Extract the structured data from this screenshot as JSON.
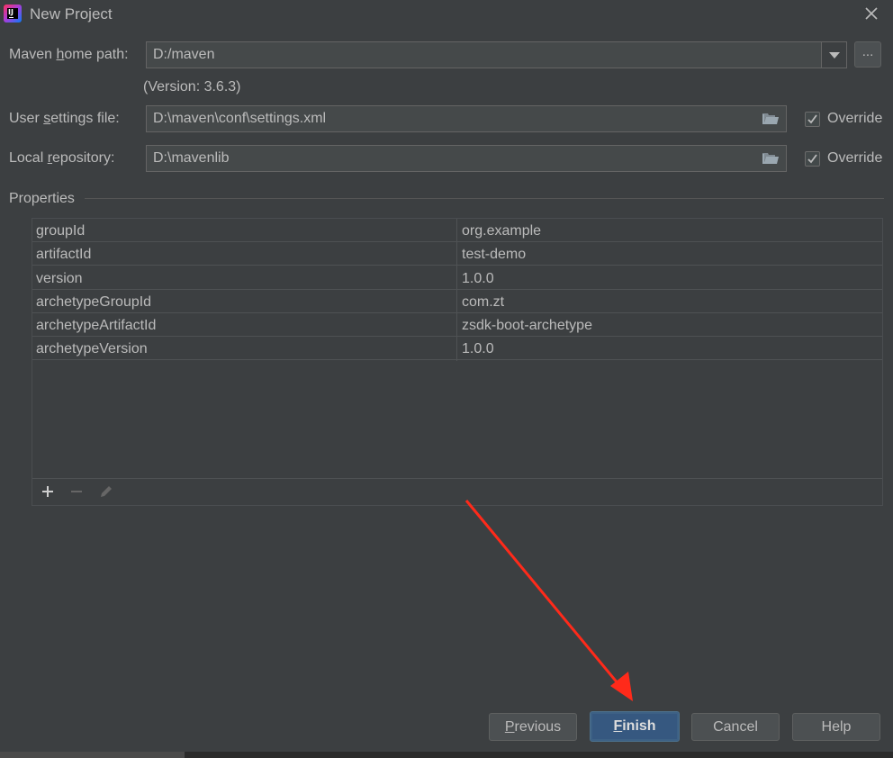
{
  "window": {
    "title": "New Project"
  },
  "maven": {
    "home_label_pre": "Maven ",
    "home_label_mn": "h",
    "home_label_post": "ome path:",
    "home_value": "D:/maven",
    "dots_label": "...",
    "version_text": "(Version: 3.6.3)",
    "settings_label_pre": "User ",
    "settings_label_mn": "s",
    "settings_label_post": "ettings file:",
    "settings_value": "D:\\maven\\conf\\settings.xml",
    "repo_label_pre": "Local ",
    "repo_label_mn": "r",
    "repo_label_post": "epository:",
    "repo_value": "D:\\mavenlib",
    "override_label": "Override"
  },
  "properties": {
    "section_label": "Properties",
    "rows": [
      {
        "key": "groupId",
        "value": "org.example"
      },
      {
        "key": "artifactId",
        "value": "test-demo"
      },
      {
        "key": "version",
        "value": "1.0.0"
      },
      {
        "key": "archetypeGroupId",
        "value": "com.zt"
      },
      {
        "key": "archetypeArtifactId",
        "value": "zsdk-boot-archetype"
      },
      {
        "key": "archetypeVersion",
        "value": "1.0.0"
      }
    ],
    "toolbar": {
      "add_icon": "plus-icon",
      "remove_icon": "minus-icon",
      "edit_icon": "pencil-icon"
    }
  },
  "buttons": {
    "previous_mn": "P",
    "previous_rest": "revious",
    "finish_mn": "F",
    "finish_rest": "inish",
    "cancel": "Cancel",
    "help": "Help"
  },
  "colors": {
    "background": "#3c3f41",
    "field": "#45494a",
    "default_button": "#365880",
    "annotation_arrow": "#ff2a1a"
  }
}
